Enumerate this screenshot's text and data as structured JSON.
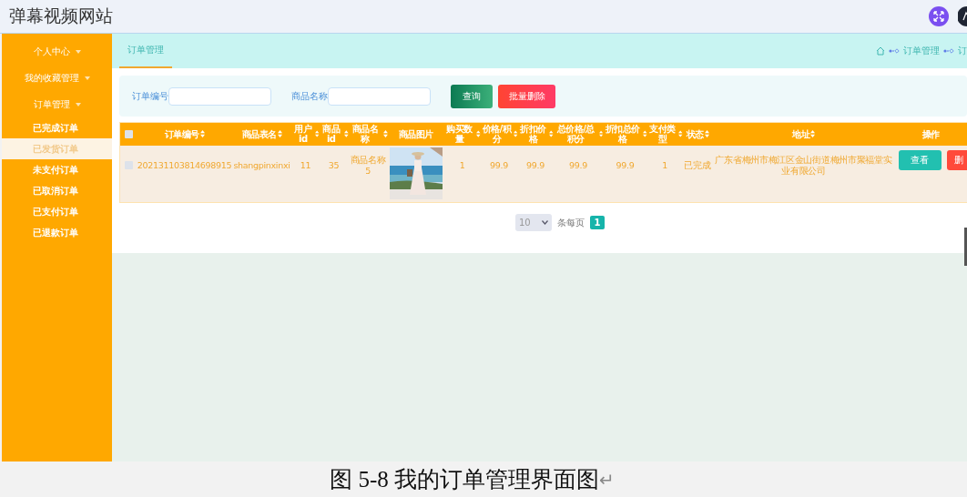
{
  "header": {
    "title": "弹幕视频网站"
  },
  "sidebar": {
    "items": [
      {
        "label": "个人中心"
      },
      {
        "label": "我的收藏管理"
      },
      {
        "label": "订单管理",
        "children": [
          {
            "label": "已完成订单",
            "selected": false
          },
          {
            "label": "已发货订单",
            "selected": true
          },
          {
            "label": "未支付订单",
            "selected": false
          },
          {
            "label": "已取消订单",
            "selected": false
          },
          {
            "label": "已支付订单",
            "selected": false
          },
          {
            "label": "已退款订单",
            "selected": false
          }
        ]
      }
    ]
  },
  "tabs": [
    {
      "label": "订单管理",
      "selected": true
    }
  ],
  "breadcrumb": [
    "订单管理",
    "订"
  ],
  "search": {
    "fields": [
      {
        "label": "订单编号"
      },
      {
        "label": "商品名称"
      }
    ],
    "buttons": [
      {
        "label": "查询",
        "kind": "primary"
      },
      {
        "label": "批量删除",
        "kind": "danger"
      }
    ]
  },
  "table": {
    "select_all": {
      "checked": false
    },
    "columns": [
      {
        "label": "订单编号",
        "sortable": true
      },
      {
        "label": "商品表名",
        "sortable": true
      },
      {
        "label": "用户id",
        "sortable": true
      },
      {
        "label": "商品id",
        "sortable": true
      },
      {
        "label": "商品名称",
        "sortable": true
      },
      {
        "label": "商品图片",
        "sortable": false
      },
      {
        "label": "购买数量",
        "sortable": true
      },
      {
        "label": "价格/积分",
        "sortable": true
      },
      {
        "label": "折扣价格",
        "sortable": true
      },
      {
        "label": "总价格/总积分",
        "sortable": true
      },
      {
        "label": "折扣总价格",
        "sortable": true
      },
      {
        "label": "支付类型",
        "sortable": true
      },
      {
        "label": "状态",
        "sortable": true
      },
      {
        "label": "地址",
        "sortable": true
      },
      {
        "label": "操作",
        "sortable": false
      }
    ],
    "rows": [
      {
        "checked": false,
        "cells": [
          {
            "kind": "text",
            "text": "202131103814698915"
          },
          {
            "kind": "text",
            "text": "shangpinxinxi"
          },
          {
            "kind": "text",
            "text": "11"
          },
          {
            "kind": "text",
            "text": "35"
          },
          {
            "kind": "text",
            "text": "商品名称5"
          },
          {
            "kind": "picture"
          },
          {
            "kind": "text",
            "text": "1"
          },
          {
            "kind": "text",
            "text": "99.9"
          },
          {
            "kind": "text",
            "text": "99.9"
          },
          {
            "kind": "text",
            "text": "99.9"
          },
          {
            "kind": "text",
            "text": "99.9"
          },
          {
            "kind": "text",
            "text": "1"
          },
          {
            "kind": "text",
            "text": "已完成"
          },
          {
            "kind": "text",
            "text": "广东省梅州市梅江区金山街道梅州市聚福堂实业有限公司"
          }
        ],
        "actions": [
          {
            "label": "查看",
            "kind": "view"
          },
          {
            "label": "删",
            "kind": "delete"
          }
        ]
      }
    ]
  },
  "pagination": {
    "page_size": "10",
    "per_page_label": "条每页",
    "pages": [
      {
        "label": "1",
        "selected": true
      }
    ]
  },
  "caption": {
    "text": "图 5-8 我的订单管理界面图",
    "mark": "↵"
  }
}
